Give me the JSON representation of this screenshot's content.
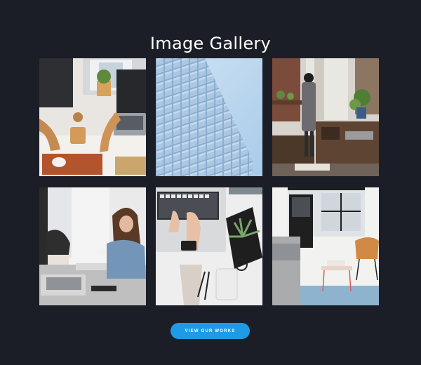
{
  "gallery": {
    "title": "Image Gallery",
    "images": [
      {
        "subject": "desk with laptop, wooden stand and small plant"
      },
      {
        "subject": "glass building facade against blue sky"
      },
      {
        "subject": "woman in hat standing by sideboard with plants"
      },
      {
        "subject": "woman working on laptop at cluttered desk"
      },
      {
        "subject": "hands typing on laptop beside plant and phone"
      },
      {
        "subject": "living room with grey sofa and orange chair"
      }
    ]
  },
  "cta": {
    "label": "VIEW OUR WORKS"
  },
  "colors": {
    "background": "#1b1e27",
    "accent": "#1e9be6",
    "title": "#ffffff"
  }
}
